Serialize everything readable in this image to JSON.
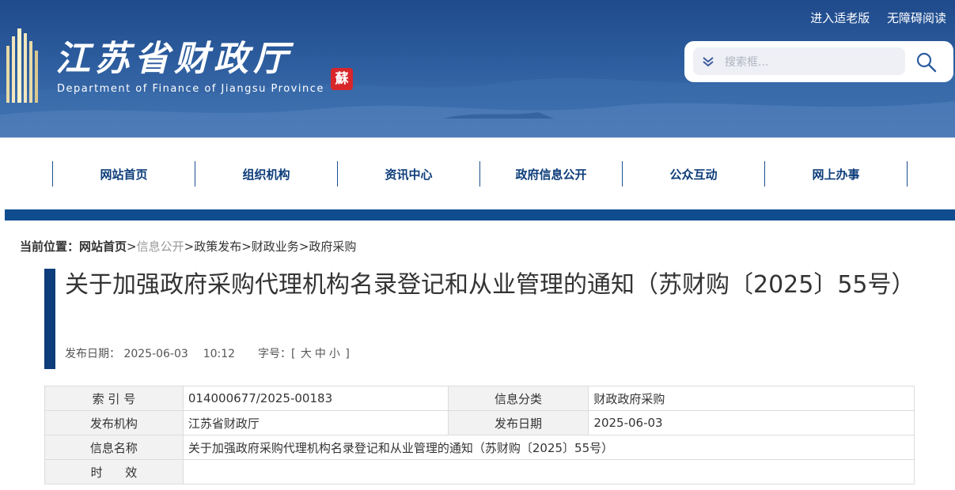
{
  "header": {
    "title": "江苏省财政厅",
    "subtitle": "Department of Finance of Jiangsu Province",
    "seal_char": "蘇",
    "top_links": [
      "进入适老版",
      "无障碍阅读"
    ],
    "search": {
      "placeholder": "搜索框..."
    }
  },
  "nav": {
    "items": [
      "网站首页",
      "组织机构",
      "资讯中心",
      "政府信息公开",
      "公众互动",
      "网上办事"
    ],
    "accent_color": "#0f4d8e"
  },
  "breadcrumb": {
    "label": "当前位置：",
    "items": [
      "网站首页",
      "信息公开",
      "政策发布",
      "财政业务",
      "政府采购"
    ],
    "separator": ">"
  },
  "article": {
    "title": "关于加强政府采购代理机构名录登记和从业管理的通知（苏财购〔2025〕55号）",
    "date_label": "发布日期：",
    "date": "2025-06-03",
    "time": "10:12",
    "font_label": "字号：",
    "font_open": "[",
    "font_sizes": [
      "大",
      "中",
      "小"
    ],
    "font_close": "]"
  },
  "info_table": {
    "index_label": "索 引 号",
    "index_value": "014000677/2025-00183",
    "category_label": "信息分类",
    "category_value": "财政政府采购",
    "publisher_label": "发布机构",
    "publisher_value": "江苏省财政厅",
    "pubdate_label": "发布日期",
    "pubdate_value": "2025-06-03",
    "name_label": "信息名称",
    "name_value": "关于加强政府采购代理机构名录登记和从业管理的通知（苏财购〔2025〕55号）",
    "validity_label": "时      效",
    "validity_value": ""
  }
}
